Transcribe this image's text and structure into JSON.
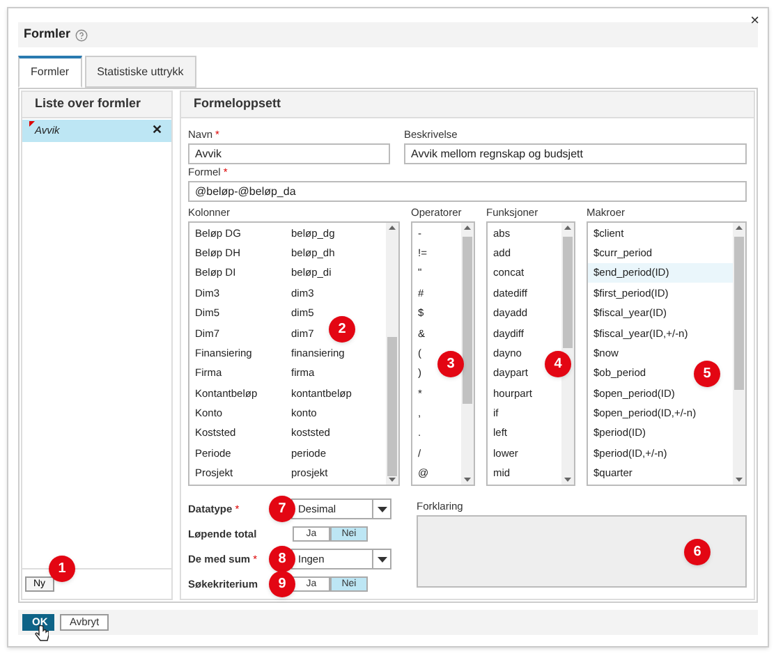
{
  "dialog": {
    "title": "Formler",
    "close": "×",
    "tabs": [
      {
        "label": "Formler",
        "selected": true
      },
      {
        "label": "Statistiske uttrykk",
        "selected": false
      }
    ],
    "list_panel": {
      "title": "Liste over formler",
      "items": [
        {
          "label": "Avvik",
          "selected": true,
          "modified": true,
          "remove": "✕"
        }
      ],
      "new_button": "Ny",
      "callout": "1"
    },
    "setup": {
      "title": "Formeloppsett",
      "name": {
        "label": "Navn",
        "mark": "*",
        "value": "Avvik"
      },
      "description": {
        "label": "Beskrivelse",
        "value": "Avvik mellom regnskap og budsjett"
      },
      "formula": {
        "label": "Formel",
        "mark": "*",
        "value": "@beløp-@beløp_da"
      },
      "columns": {
        "label": "Kolonner",
        "callout": "2",
        "rows": [
          [
            "Beløp DG",
            "beløp_dg"
          ],
          [
            "Beløp DH",
            "beløp_dh"
          ],
          [
            "Beløp DI",
            "beløp_di"
          ],
          [
            "Dim3",
            "dim3"
          ],
          [
            "Dim5",
            "dim5"
          ],
          [
            "Dim7",
            "dim7"
          ],
          [
            "Finansiering",
            "finansiering"
          ],
          [
            "Firma",
            "firma"
          ],
          [
            "Kontantbeløp",
            "kontantbeløp"
          ],
          [
            "Konto",
            "konto"
          ],
          [
            "Koststed",
            "koststed"
          ],
          [
            "Periode",
            "periode"
          ],
          [
            "Prosjekt",
            "prosjekt"
          ]
        ]
      },
      "operators": {
        "label": "Operatorer",
        "callout": "3",
        "items": [
          "-",
          "!=",
          "\"",
          "#",
          "$",
          "&",
          "(",
          ")",
          "*",
          ",",
          ".",
          "/",
          "@"
        ]
      },
      "functions": {
        "label": "Funksjoner",
        "callout": "4",
        "items": [
          "abs",
          "add",
          "concat",
          "datediff",
          "dayadd",
          "daydiff",
          "dayno",
          "daypart",
          "hourpart",
          "if",
          "left",
          "lower",
          "mid"
        ]
      },
      "macros": {
        "label": "Makroer",
        "callout": "5",
        "items": [
          {
            "label": "$client",
            "selected": false
          },
          {
            "label": "$curr_period",
            "selected": false
          },
          {
            "label": "$end_period(ID)",
            "selected": true
          },
          {
            "label": "$first_period(ID)",
            "selected": false
          },
          {
            "label": "$fiscal_year(ID)",
            "selected": false
          },
          {
            "label": "$fiscal_year(ID,+/-n)",
            "selected": false
          },
          {
            "label": "$now",
            "selected": false
          },
          {
            "label": "$ob_period",
            "selected": false
          },
          {
            "label": "$open_period(ID)",
            "selected": false
          },
          {
            "label": "$open_period(ID,+/-n)",
            "selected": false
          },
          {
            "label": "$period(ID)",
            "selected": false
          },
          {
            "label": "$period(ID,+/-n)",
            "selected": false
          },
          {
            "label": "$quarter",
            "selected": false
          }
        ]
      },
      "options": [
        {
          "kind": "select",
          "label": "Datatype",
          "mark": "*",
          "value": "Desimal",
          "callout": "7"
        },
        {
          "kind": "toggle",
          "label": "Løpende total",
          "choices": [
            {
              "label": "Ja",
              "selected": false
            },
            {
              "label": "Nei",
              "selected": true
            }
          ]
        },
        {
          "kind": "select",
          "label": "De med sum",
          "mark": "*",
          "value": "Ingen",
          "callout": "8"
        },
        {
          "kind": "toggle",
          "label": "Søkekriterium",
          "callout": "9",
          "choices": [
            {
              "label": "Ja",
              "selected": false
            },
            {
              "label": "Nei",
              "selected": true
            }
          ]
        }
      ],
      "explanation": {
        "label": "Forklaring",
        "callout": "6"
      }
    },
    "buttons": [
      {
        "label": "OK",
        "primary": true
      },
      {
        "label": "Avbryt",
        "primary": false
      }
    ]
  }
}
